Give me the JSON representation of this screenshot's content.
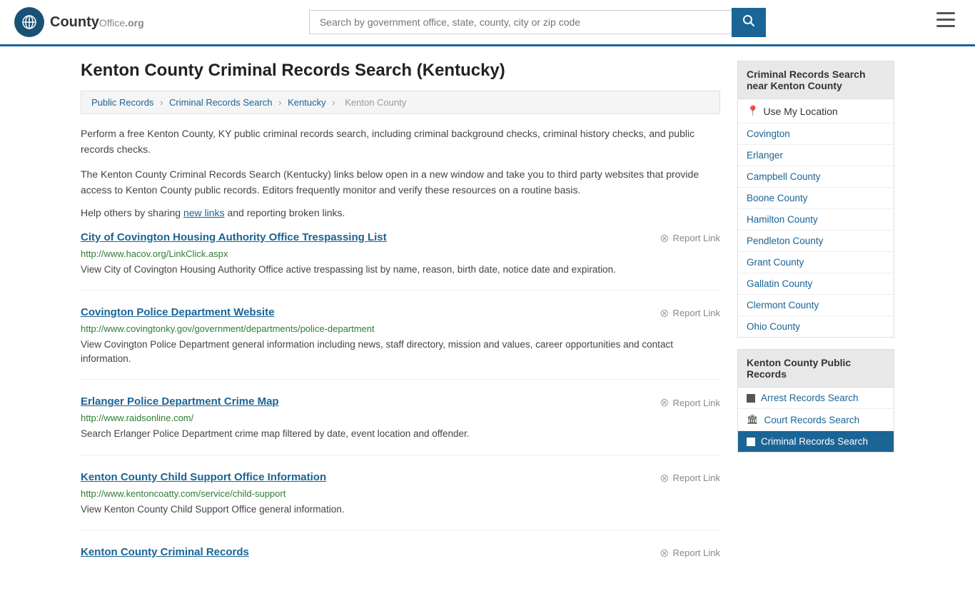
{
  "header": {
    "logo_text": "County",
    "logo_org": "Office",
    "logo_domain": ".org",
    "search_placeholder": "Search by government office, state, county, city or zip code",
    "search_btn_icon": "🔍"
  },
  "page": {
    "title": "Kenton County Criminal Records Search (Kentucky)"
  },
  "breadcrumb": {
    "items": [
      "Public Records",
      "Criminal Records Search",
      "Kentucky",
      "Kenton County"
    ]
  },
  "intro": {
    "p1": "Perform a free Kenton County, KY public criminal records search, including criminal background checks, criminal history checks, and public records checks.",
    "p2": "The Kenton County Criminal Records Search (Kentucky) links below open in a new window and take you to third party websites that provide access to Kenton County public records. Editors frequently monitor and verify these resources on a routine basis.",
    "p3_before": "Help others by sharing ",
    "p3_link": "new links",
    "p3_after": " and reporting broken links."
  },
  "results": [
    {
      "title": "City of Covington Housing Authority Office Trespassing List",
      "url": "http://www.hacov.org/LinkClick.aspx",
      "desc": "View City of Covington Housing Authority Office active trespassing list by name, reason, birth date, notice date and expiration.",
      "report": "Report Link"
    },
    {
      "title": "Covington Police Department Website",
      "url": "http://www.covingtonky.gov/government/departments/police-department",
      "desc": "View Covington Police Department general information including news, staff directory, mission and values, career opportunities and contact information.",
      "report": "Report Link"
    },
    {
      "title": "Erlanger Police Department Crime Map",
      "url": "http://www.raidsonline.com/",
      "desc": "Search Erlanger Police Department crime map filtered by date, event location and offender.",
      "report": "Report Link"
    },
    {
      "title": "Kenton County Child Support Office Information",
      "url": "http://www.kentoncoatty.com/service/child-support",
      "desc": "View Kenton County Child Support Office general information.",
      "report": "Report Link"
    },
    {
      "title": "Kenton County Criminal Records",
      "url": "",
      "desc": "",
      "report": "Report Link"
    }
  ],
  "sidebar": {
    "section1_title": "Criminal Records Search near Kenton County",
    "use_location": "Use My Location",
    "nearby_links": [
      "Covington",
      "Erlanger",
      "Campbell County",
      "Boone County",
      "Hamilton County",
      "Pendleton County",
      "Grant County",
      "Gallatin County",
      "Clermont County",
      "Ohio County"
    ],
    "section2_title": "Kenton County Public Records",
    "public_links": [
      {
        "label": "Arrest Records Search",
        "icon": "square"
      },
      {
        "label": "Court Records Search",
        "icon": "building"
      },
      {
        "label": "Criminal Records Search",
        "icon": "square",
        "highlighted": true
      }
    ]
  }
}
